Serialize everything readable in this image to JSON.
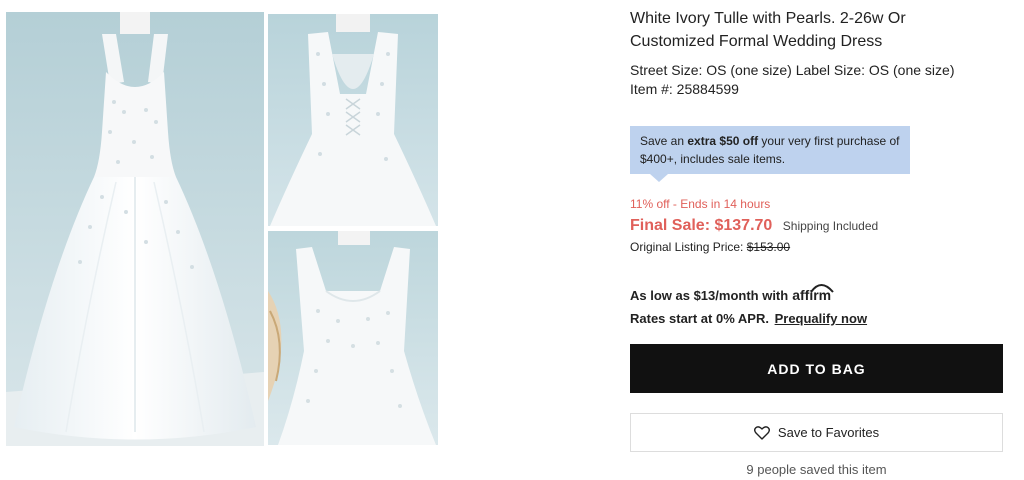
{
  "gallery": {
    "images": [
      {
        "name": "dress-front-full"
      },
      {
        "name": "dress-back-detail"
      },
      {
        "name": "dress-bodice-detail"
      }
    ]
  },
  "product": {
    "title": "White Ivory Tulle with Pearls. 2-26w Or Customized Formal Wedding Dress",
    "size_line": "Street Size: OS (one size) Label Size: OS (one size)",
    "item_number": "Item #: 25884599"
  },
  "promo": {
    "prefix": "Save an ",
    "bold": "extra $50 off",
    "suffix": " your very first purchase of $400+, includes sale items."
  },
  "pricing": {
    "discount_text": "11% off - Ends in 14 hours",
    "final_label": "Final Sale: ",
    "final_price": "$137.70",
    "shipping": "Shipping Included",
    "original_label": "Original Listing Price: ",
    "original_price": "$153.00",
    "accent_color": "#e0605a"
  },
  "financing": {
    "as_low_as": "As low as $13/month with",
    "affirm_logo": "affirm",
    "rates": "Rates start at 0% APR.",
    "prequalify": "Prequalify now"
  },
  "actions": {
    "add_to_bag": "ADD TO BAG",
    "save_favorites": "Save to Favorites",
    "heart_icon": "heart-icon",
    "saved_count": "9 people saved this item"
  }
}
